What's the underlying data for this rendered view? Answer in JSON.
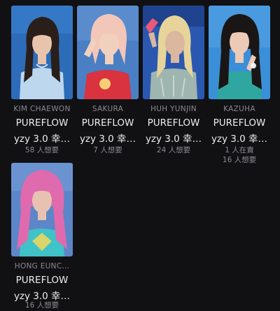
{
  "cards": [
    {
      "member": "KIM CHAEWON",
      "brand": "PUREFLOW",
      "product": "yzy 3.0 幸…",
      "stats": [
        "58 人想要"
      ],
      "photo_icon": "photocard-image",
      "palette": {
        "bg": "#2d6cb8",
        "hair": "#2a1e1a",
        "skin": "#e8c4ad",
        "top": "#bcd7ee"
      }
    },
    {
      "member": "SAKURA",
      "brand": "PUREFLOW",
      "product": "yzy 3.0 幸…",
      "stats": [
        "7 人想要"
      ],
      "photo_icon": "photocard-image",
      "palette": {
        "bg": "#4a7fc4",
        "hair": "#f2c6b8",
        "skin": "#f1d1bd",
        "top": "#d9333f"
      }
    },
    {
      "member": "HUH YUNJIN",
      "brand": "PUREFLOW",
      "product": "yzy 3.0 幸…",
      "stats": [
        "24 人想要"
      ],
      "photo_icon": "photocard-image",
      "palette": {
        "bg": "#2a58b0",
        "hair": "#e6d49a",
        "skin": "#dbb79f",
        "top": "#9fb5b0"
      }
    },
    {
      "member": "KAZUHA",
      "brand": "PUREFLOW",
      "product": "yzy 3.0 幸…",
      "stats": [
        "1 人在賣",
        "16 人想要"
      ],
      "photo_icon": "photocard-image",
      "palette": {
        "bg": "#3b8fd8",
        "hair": "#1a1616",
        "skin": "#eccab6",
        "top": "#2fa6a0"
      }
    },
    {
      "member": "HONG EUNC…",
      "brand": "PUREFLOW",
      "product": "yzy 3.0 幸…",
      "stats": [
        "16 人想要"
      ],
      "photo_icon": "photocard-image",
      "palette": {
        "bg": "#5d86c8",
        "hair": "#e06aae",
        "skin": "#e7c2b0",
        "top": "#3fc2c8"
      }
    }
  ]
}
